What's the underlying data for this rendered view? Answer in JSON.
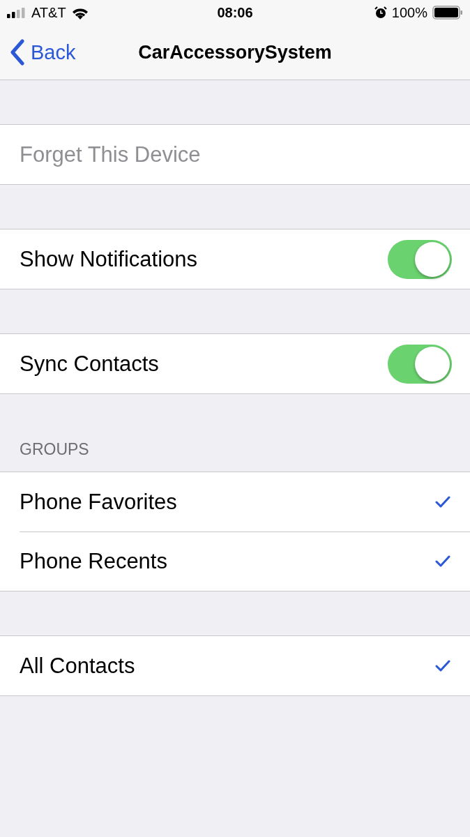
{
  "status_bar": {
    "carrier": "AT&T",
    "time": "08:06",
    "battery": "100%"
  },
  "nav": {
    "back": "Back",
    "title": "CarAccessorySystem"
  },
  "sections": [
    {
      "rows": [
        {
          "kind": "action",
          "label": "Forget This Device",
          "disabled": true
        }
      ]
    },
    {
      "rows": [
        {
          "kind": "toggle",
          "label": "Show Notifications",
          "on": true
        }
      ]
    },
    {
      "rows": [
        {
          "kind": "toggle",
          "label": "Sync Contacts",
          "on": true
        }
      ]
    },
    {
      "header": "GROUPS",
      "rows": [
        {
          "kind": "check",
          "label": "Phone Favorites",
          "checked": true
        },
        {
          "kind": "check",
          "label": "Phone Recents",
          "checked": true
        }
      ]
    },
    {
      "rows": [
        {
          "kind": "check",
          "label": "All Contacts",
          "checked": true
        }
      ]
    }
  ]
}
